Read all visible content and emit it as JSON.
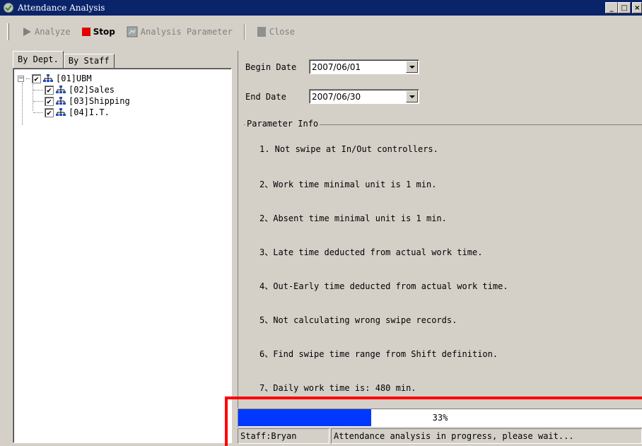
{
  "window": {
    "title": "Attendance Analysis",
    "controls": {
      "minimize": "_",
      "maximize": "□",
      "close": "×"
    }
  },
  "toolbar": {
    "analyze_label": "Analyze",
    "stop_label": "Stop",
    "params_label": "Analysis Parameter",
    "close_label": "Close"
  },
  "tabs": {
    "by_dept": "By Dept.",
    "by_staff": "By Staff"
  },
  "tree": {
    "root": {
      "label": "[01]UBM",
      "checked": true,
      "expander": "−"
    },
    "children": [
      {
        "label": "[02]Sales",
        "checked": true
      },
      {
        "label": "[03]Shipping",
        "checked": true
      },
      {
        "label": "[04]I.T.",
        "checked": true
      }
    ]
  },
  "dates": {
    "begin_label": "Begin Date",
    "begin_value": "2007/06/01",
    "end_label": "End Date",
    "end_value": "2007/06/30"
  },
  "params": {
    "group_title": "Parameter Info",
    "lines": [
      "1. Not swipe at In/Out controllers.",
      "2、Work time minimal unit is 1 min.",
      "2、Absent time minimal unit is 1 min.",
      "3、Late time deducted from actual work time.",
      "4、Out-Early time deducted from actual work time.",
      "5、Not calculating wrong swipe records.",
      "6、Find swipe time range from Shift definition.",
      "7、Daily work time is: 480 min."
    ]
  },
  "progress": {
    "percent": 33,
    "text": "33%"
  },
  "status": {
    "staff": "Staff:Bryan",
    "message": "Attendance analysis in progress, please wait..."
  },
  "colors": {
    "titlebar": "#0a246a",
    "progress": "#0038ff",
    "highlight": "#ff0000",
    "stop_icon": "#e00000"
  }
}
